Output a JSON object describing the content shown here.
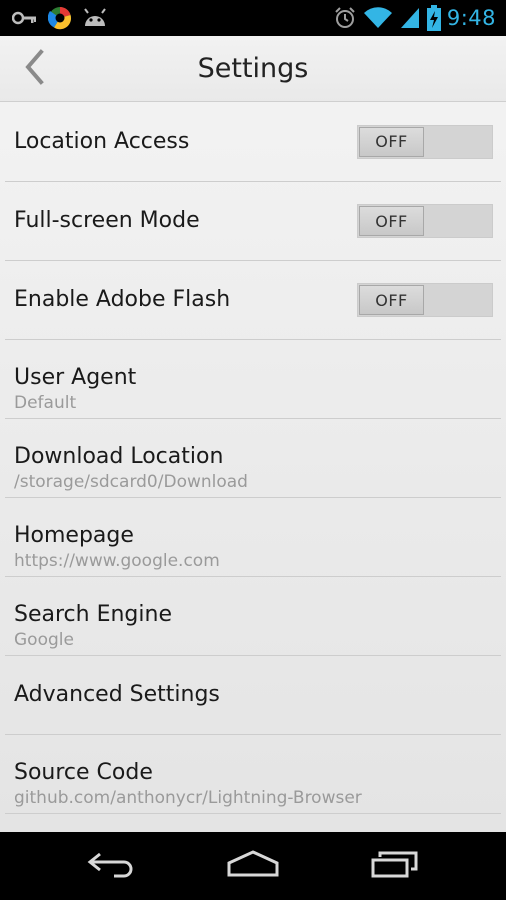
{
  "status_bar": {
    "time": "9:48",
    "left_icons": [
      "key-icon",
      "chrome-like-icon",
      "android-icon"
    ],
    "right_icons": [
      "alarm-icon",
      "wifi-icon",
      "signal-icon",
      "battery-charging-icon"
    ],
    "accent": "#33b5e5"
  },
  "header": {
    "title": "Settings",
    "back_icon": "chevron-left-icon"
  },
  "settings": [
    {
      "title": "Location Access",
      "toggle": "OFF"
    },
    {
      "title": "Full-screen Mode",
      "toggle": "OFF"
    },
    {
      "title": "Enable Adobe Flash",
      "toggle": "OFF"
    },
    {
      "title": "User Agent",
      "subtitle": "Default"
    },
    {
      "title": "Download Location",
      "subtitle": "/storage/sdcard0/Download"
    },
    {
      "title": "Homepage",
      "subtitle": "https://www.google.com"
    },
    {
      "title": "Search Engine",
      "subtitle": "Google"
    },
    {
      "title": "Advanced Settings"
    },
    {
      "title": "Source Code",
      "subtitle": "github.com/anthonycr/Lightning-Browser"
    }
  ],
  "nav_bar": {
    "buttons": [
      "back-arrow-icon",
      "home-icon",
      "recent-apps-icon"
    ]
  }
}
